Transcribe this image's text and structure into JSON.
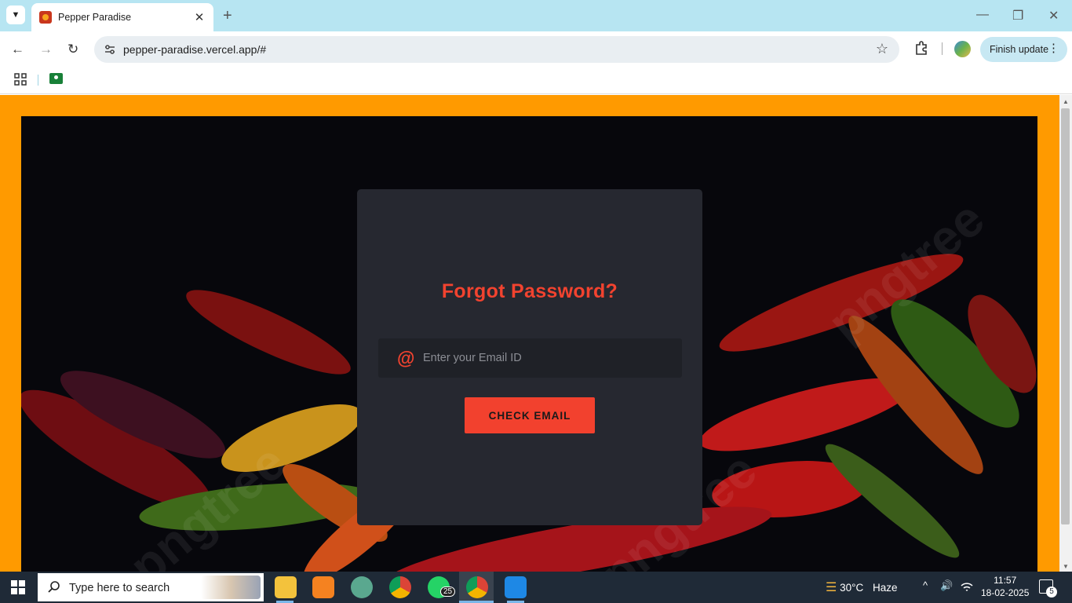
{
  "browser": {
    "tab": {
      "title": "Pepper Paradise",
      "close_glyph": "✕"
    },
    "new_tab_glyph": "+",
    "window_controls": {
      "minimize": "—",
      "restore": "❐",
      "close": "✕"
    },
    "nav": {
      "back": "←",
      "forward": "→",
      "reload": "↻"
    },
    "address": {
      "url": "pepper-paradise.vercel.app/#",
      "star_glyph": "☆"
    },
    "finish_update": {
      "label": "Finish update",
      "menu_glyph": "⋮"
    }
  },
  "page": {
    "title": "Forgot Password?",
    "email_icon_glyph": "@",
    "email_placeholder": "Enter your Email ID",
    "email_value": "",
    "check_button_label": "CHECK EMAIL",
    "watermark": "pngtree",
    "colors": {
      "accent": "#f2432f",
      "frame": "#ff9a00",
      "card": "#262830"
    }
  },
  "taskbar": {
    "search_placeholder": "Type here to search",
    "whatsapp_badge": "25",
    "weather": {
      "temp": "30°C",
      "condition": "Haze"
    },
    "tray": {
      "chevron": "^",
      "volume": "🔊"
    },
    "clock": {
      "time": "11:57",
      "date": "18-02-2025"
    },
    "notifications_count": "5"
  }
}
